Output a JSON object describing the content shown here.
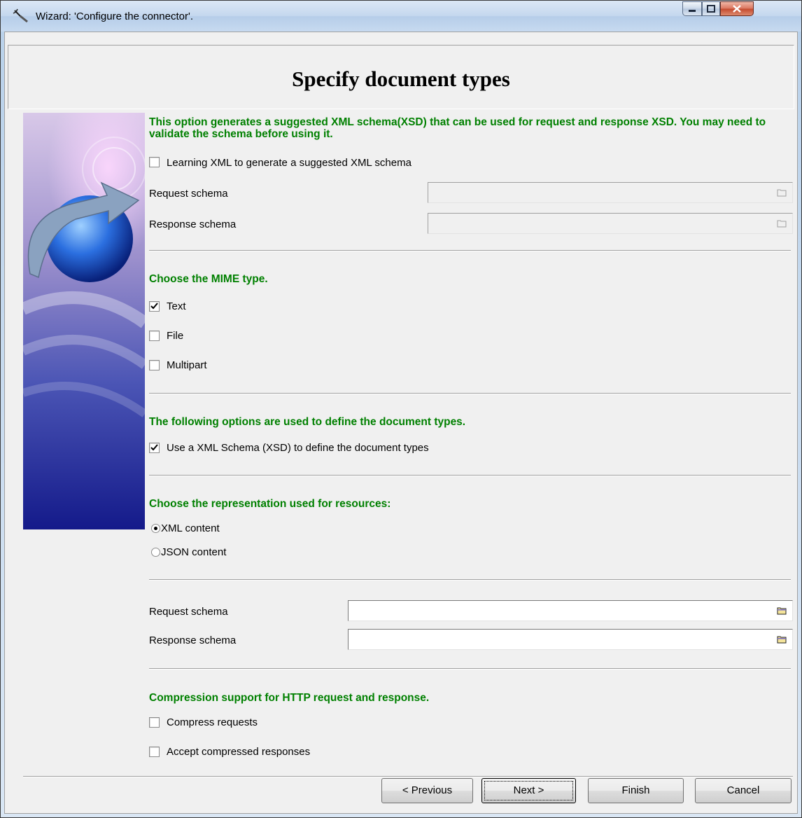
{
  "window": {
    "title": "Wizard: 'Configure the connector'."
  },
  "header": {
    "title": "Specify document types"
  },
  "learning": {
    "description": "This option generates a suggested XML schema(XSD) that can be used for request and response XSD. You may need to validate the schema before using it.",
    "checkbox_label": "Learning XML to generate a suggested XML schema",
    "checked": false,
    "request_label": "Request schema",
    "response_label": "Response schema",
    "request_value": "",
    "response_value": ""
  },
  "mime": {
    "heading": "Choose the MIME type.",
    "options": [
      {
        "label": "Text",
        "checked": true
      },
      {
        "label": "File",
        "checked": false
      },
      {
        "label": "Multipart",
        "checked": false
      }
    ]
  },
  "doctypes": {
    "heading": "The following options are used to define the document types.",
    "checkbox_label": "Use a XML Schema (XSD) to define the document types",
    "checked": true
  },
  "representation": {
    "heading": "Choose the representation used for resources:",
    "options": [
      {
        "label": "XML content",
        "selected": true
      },
      {
        "label": "JSON content",
        "selected": false
      }
    ]
  },
  "schemas": {
    "request_label": "Request schema",
    "response_label": "Response schema",
    "request_value": "",
    "response_value": ""
  },
  "compression": {
    "heading": "Compression support for HTTP request and response.",
    "options": [
      {
        "label": "Compress requests",
        "checked": false
      },
      {
        "label": "Accept compressed responses",
        "checked": false
      }
    ]
  },
  "buttons": {
    "previous": "< Previous",
    "next": "Next >",
    "finish": "Finish",
    "cancel": "Cancel"
  },
  "icons": [
    "wizard-icon",
    "minimize-icon",
    "maximize-icon",
    "close-icon",
    "folder-icon",
    "checkmark-icon"
  ]
}
